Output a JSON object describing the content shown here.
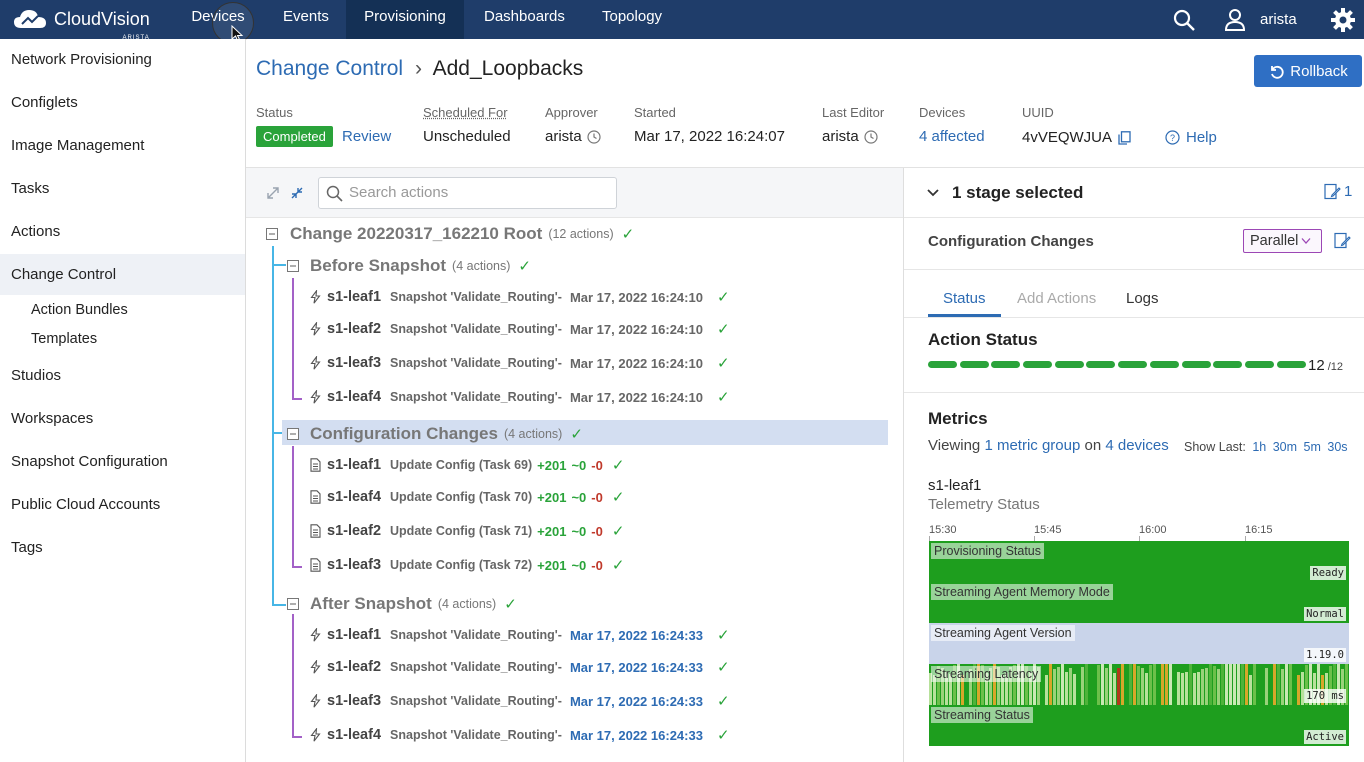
{
  "app": {
    "logo_text": "CloudVision",
    "logo_sub": "ARISTA"
  },
  "nav": {
    "items": [
      "Devices",
      "Events",
      "Provisioning",
      "Dashboards",
      "Topology"
    ],
    "active": "Provisioning",
    "user": "arista"
  },
  "sidebar": {
    "items": [
      {
        "label": "Network Provisioning"
      },
      {
        "label": "Configlets"
      },
      {
        "label": "Image Management"
      },
      {
        "label": "Tasks"
      },
      {
        "label": "Actions"
      },
      {
        "label": "Change Control"
      },
      {
        "label": "Action Bundles"
      },
      {
        "label": "Templates"
      },
      {
        "label": "Studios"
      },
      {
        "label": "Workspaces"
      },
      {
        "label": "Snapshot Configuration"
      },
      {
        "label": "Public Cloud Accounts"
      },
      {
        "label": "Tags"
      }
    ],
    "active": "Change Control"
  },
  "breadcrumb": {
    "parent": "Change Control",
    "separator": "›",
    "current": "Add_Loopbacks"
  },
  "rollback_label": "Rollback",
  "meta": {
    "status_label": "Status",
    "status_value": "Completed",
    "review": "Review",
    "scheduled_label": "Scheduled For",
    "scheduled_value": "Unscheduled",
    "approver_label": "Approver",
    "approver_value": "arista",
    "started_label": "Started",
    "started_value": "Mar 17, 2022 16:24:07",
    "editor_label": "Last Editor",
    "editor_value": "arista",
    "devices_label": "Devices",
    "devices_value": "4 affected",
    "uuid_label": "UUID",
    "uuid_value": "4vVEQWJUA",
    "help": "Help"
  },
  "search": {
    "placeholder": "Search actions"
  },
  "tree": {
    "root": {
      "title": "Change 20220317_162210 Root",
      "count": "(12 actions)"
    },
    "groups": [
      {
        "title": "Before Snapshot",
        "count": "(4 actions)",
        "type": "snapshot",
        "rows": [
          {
            "device": "s1-leaf1",
            "action": "Snapshot 'Validate_Routing'-",
            "time": "Mar 17, 2022 16:24:10"
          },
          {
            "device": "s1-leaf2",
            "action": "Snapshot 'Validate_Routing'-",
            "time": "Mar 17, 2022 16:24:10"
          },
          {
            "device": "s1-leaf3",
            "action": "Snapshot 'Validate_Routing'-",
            "time": "Mar 17, 2022 16:24:10"
          },
          {
            "device": "s1-leaf4",
            "action": "Snapshot 'Validate_Routing'-",
            "time": "Mar 17, 2022 16:24:10"
          }
        ]
      },
      {
        "title": "Configuration Changes",
        "count": "(4 actions)",
        "type": "config",
        "rows": [
          {
            "device": "s1-leaf1",
            "action": "Update Config (Task 69)",
            "plus": "+201",
            "tilde": "~0",
            "minus": "-0"
          },
          {
            "device": "s1-leaf4",
            "action": "Update Config (Task 70)",
            "plus": "+201",
            "tilde": "~0",
            "minus": "-0"
          },
          {
            "device": "s1-leaf2",
            "action": "Update Config (Task 71)",
            "plus": "+201",
            "tilde": "~0",
            "minus": "-0"
          },
          {
            "device": "s1-leaf3",
            "action": "Update Config (Task 72)",
            "plus": "+201",
            "tilde": "~0",
            "minus": "-0"
          }
        ]
      },
      {
        "title": "After Snapshot",
        "count": "(4 actions)",
        "type": "snapshot",
        "rows": [
          {
            "device": "s1-leaf1",
            "action": "Snapshot 'Validate_Routing'-",
            "time": "Mar 17, 2022 16:24:33"
          },
          {
            "device": "s1-leaf2",
            "action": "Snapshot 'Validate_Routing'-",
            "time": "Mar 17, 2022 16:24:33"
          },
          {
            "device": "s1-leaf3",
            "action": "Snapshot 'Validate_Routing'-",
            "time": "Mar 17, 2022 16:24:33"
          },
          {
            "device": "s1-leaf4",
            "action": "Snapshot 'Validate_Routing'-",
            "time": "Mar 17, 2022 16:24:33"
          }
        ]
      }
    ]
  },
  "right": {
    "stage_selected": "1 stage selected",
    "stage_count": "1",
    "stage_name": "Configuration Changes",
    "mode": "Parallel",
    "tabs": [
      "Status",
      "Add Actions",
      "Logs"
    ],
    "active_tab": "Status",
    "action_status_title": "Action Status",
    "action_done": 12,
    "action_total": 12,
    "action_count_text": "12",
    "action_total_text": "/12",
    "metrics_title": "Metrics",
    "viewing_prefix": "Viewing",
    "metric_group": "1 metric group",
    "on_word": "on",
    "devices_link": "4 devices",
    "show_last_label": "Show Last:",
    "ranges": [
      "1h",
      "30m",
      "5m",
      "30s"
    ],
    "telemetry_device": "s1-leaf1",
    "telemetry_sub": "Telemetry Status",
    "time_ticks": [
      "15:30",
      "15:45",
      "16:00",
      "16:15"
    ],
    "bands": [
      {
        "label": "Provisioning Status",
        "value": "Ready",
        "color": "#1e9e1e"
      },
      {
        "label": "Streaming Agent Memory Mode",
        "value": "Normal",
        "color": "#1e9e1e"
      },
      {
        "label": "Streaming Agent Version",
        "value": "1.19.0",
        "color": "#c9d4ea"
      },
      {
        "label": "Streaming Latency",
        "value": "170 ms",
        "color": "#1e9e1e"
      },
      {
        "label": "Streaming Status",
        "value": "Active",
        "color": "#1e9e1e"
      }
    ]
  },
  "colors": {
    "nav_bg": "#1f3d6a",
    "accent": "#2d6bb3",
    "success": "#2aa33a"
  }
}
